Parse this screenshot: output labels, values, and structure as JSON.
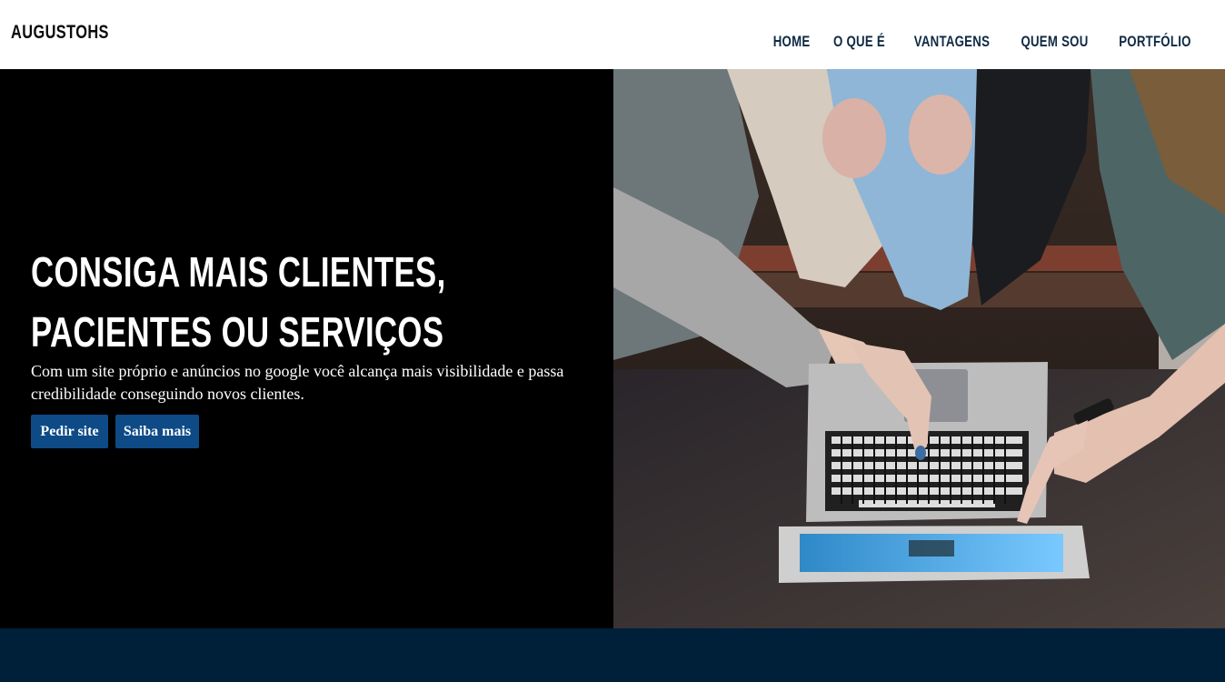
{
  "header": {
    "brand": "AUGUSTOHS",
    "nav": [
      {
        "label": "HOME"
      },
      {
        "label": "O QUE É"
      },
      {
        "label": "VANTAGENS"
      },
      {
        "label": "QUEM SOU"
      },
      {
        "label": "PORTFÓLIO"
      }
    ]
  },
  "hero": {
    "title": "CONSIGA MAIS CLIENTES, PACIENTES OU SERVIÇOS",
    "text": "Com um site próprio e anúncios no google você alcança mais visibilidade e passa credibilidade conseguindo novos clientes.",
    "buttons": {
      "primary": "Pedir site",
      "secondary": "Saiba mais"
    },
    "image_icon": "laptop-collaboration-photo"
  },
  "colors": {
    "nav_text": "#0f2a44",
    "hero_bg": "#000000",
    "button_bg": "#0d4a86",
    "footer_band": "#00203a"
  }
}
